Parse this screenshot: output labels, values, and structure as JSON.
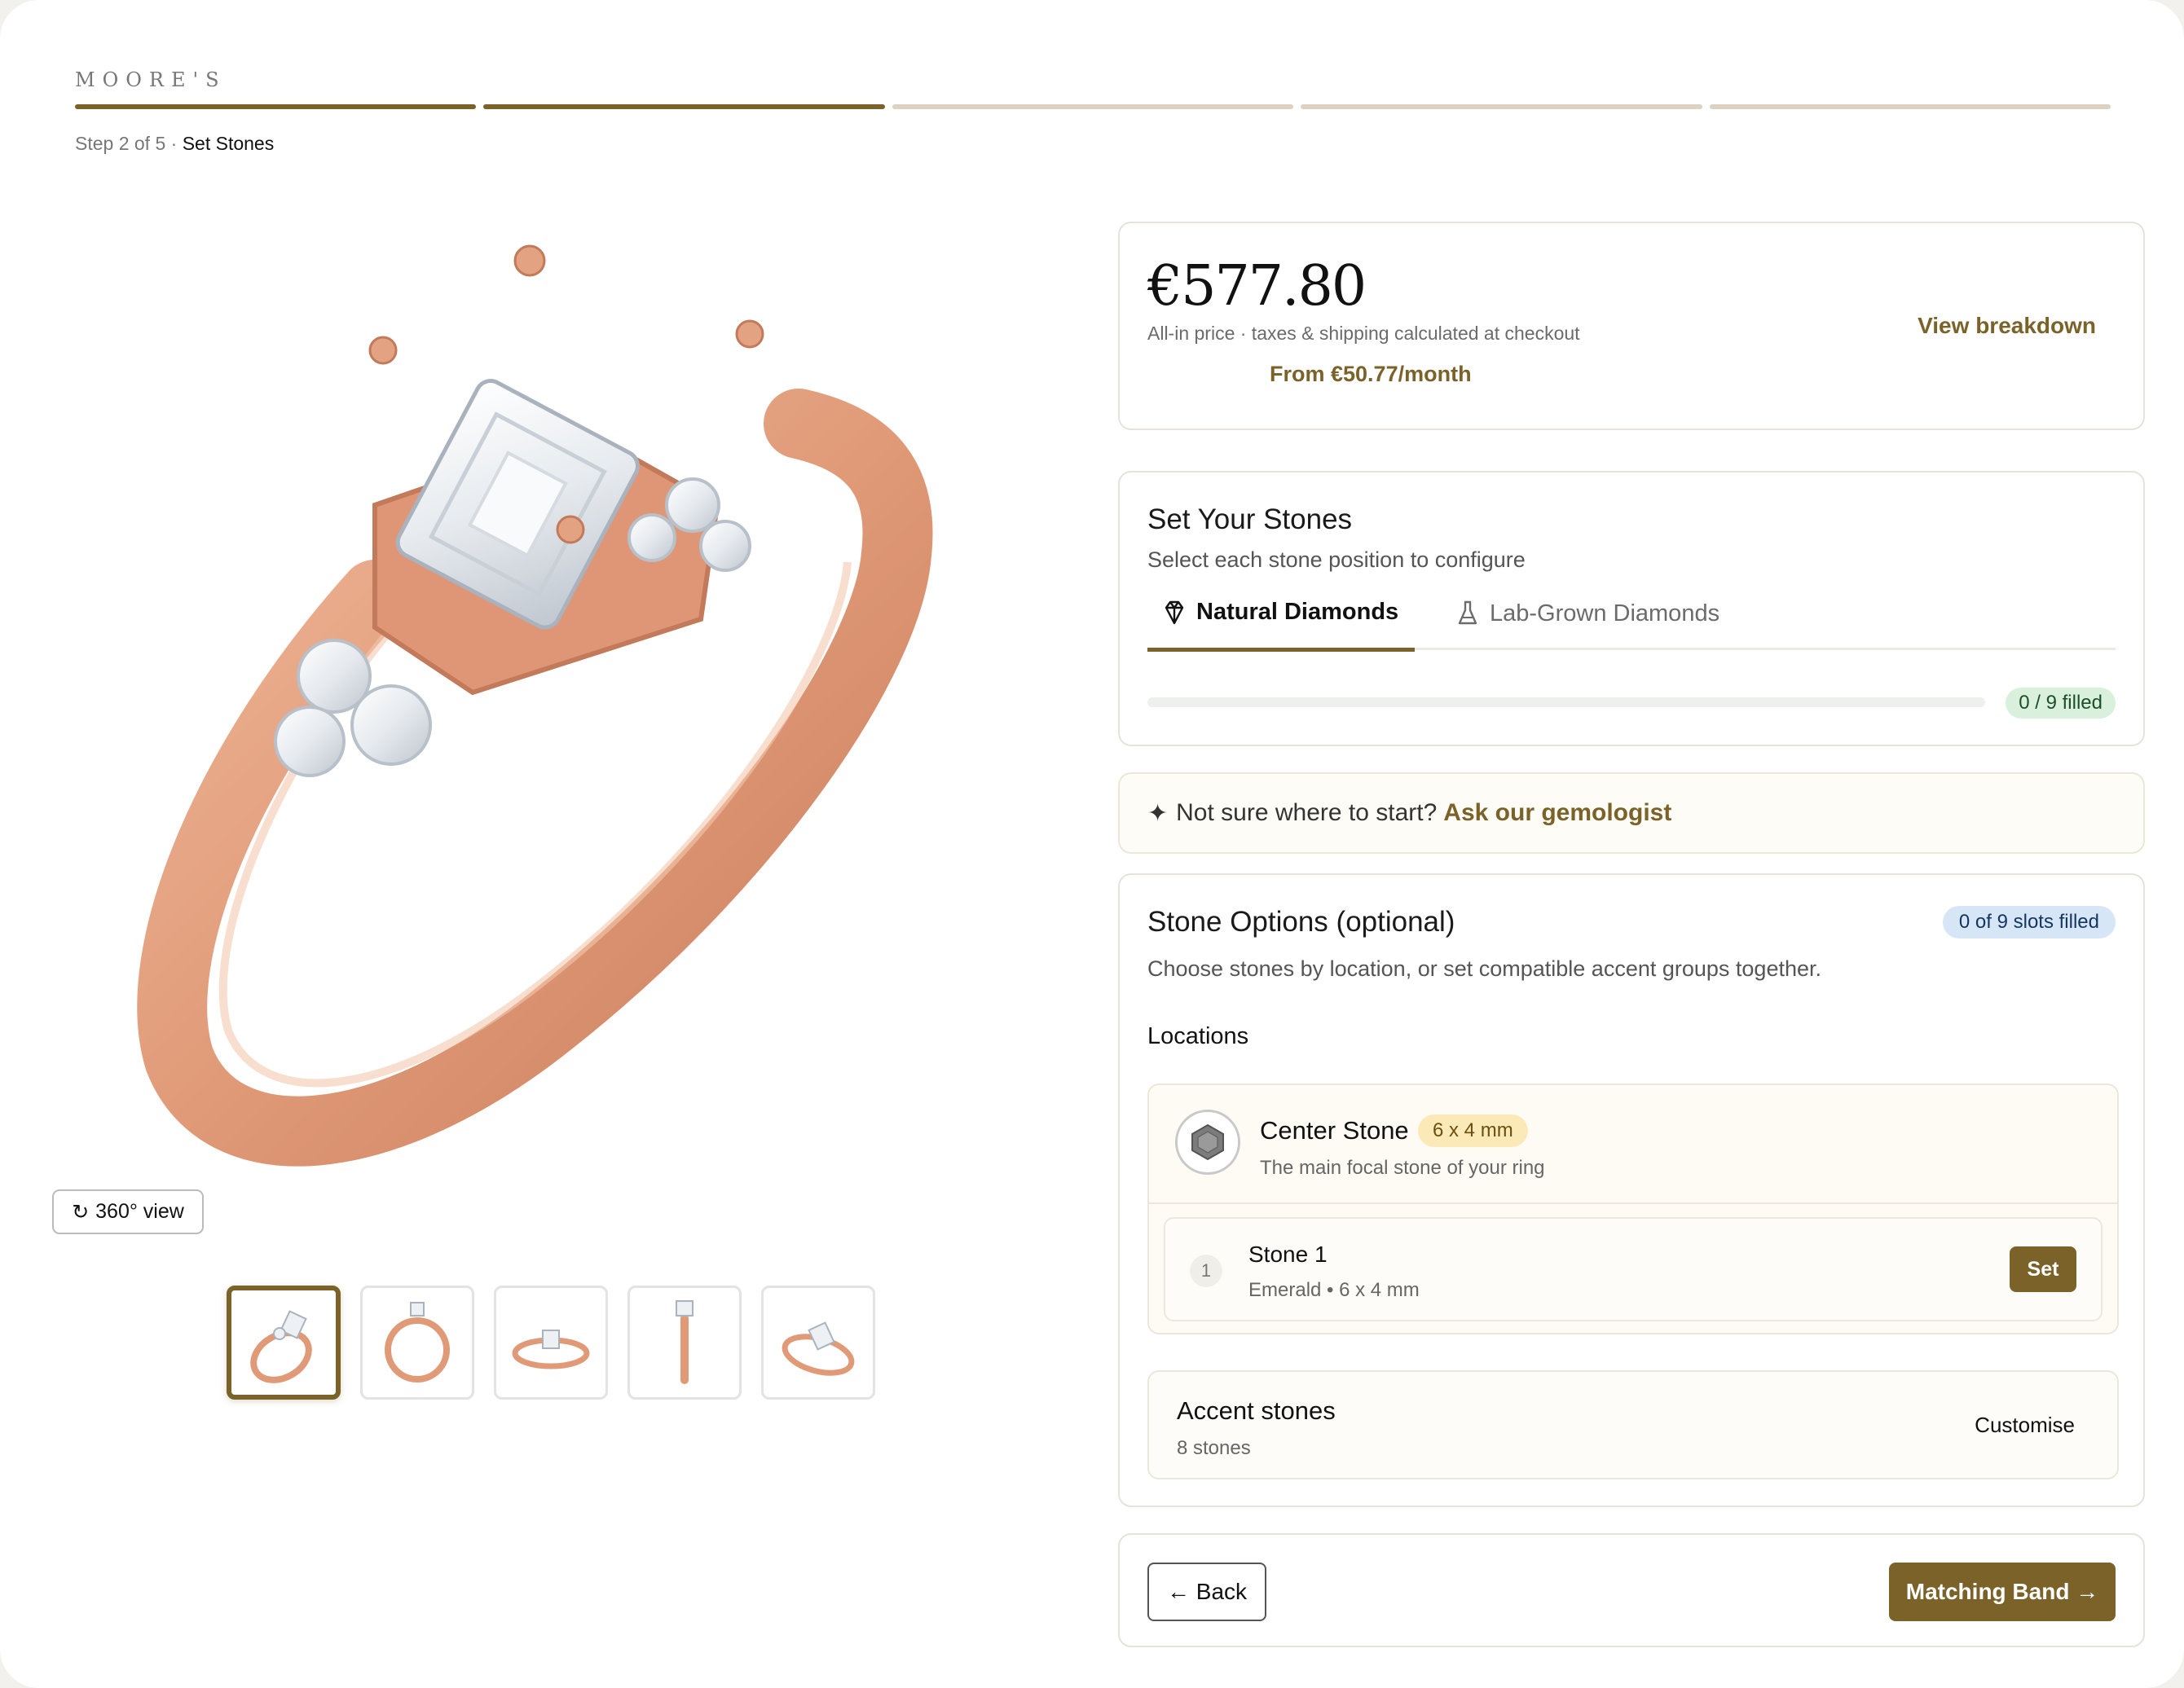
{
  "brand": "MOORE'S",
  "progress": {
    "total_steps": 5,
    "completed_steps": 2
  },
  "step": {
    "prefix": "Step 2 of 5 · ",
    "current": "Set Stones"
  },
  "gallery": {
    "view360_label": "360° view",
    "thumbnails": [
      "ring-angle-view",
      "ring-front-view",
      "ring-top-view",
      "ring-side-view",
      "ring-perspective-view"
    ],
    "active_thumbnail": 0,
    "metal_color": "#e3a383"
  },
  "price": {
    "amount": "€577.80",
    "note": "All-in price · taxes & shipping calculated at checkout",
    "monthly": "From €50.77/month",
    "breakdown_link": "View breakdown"
  },
  "set_stones": {
    "title": "Set Your Stones",
    "subtitle": "Select each stone position to configure",
    "tabs": [
      {
        "label": "Natural Diamonds",
        "icon": "diamond-icon",
        "active": true
      },
      {
        "label": "Lab-Grown Diamonds",
        "icon": "flask-icon",
        "active": false
      }
    ],
    "filled_label": "0 / 9 filled",
    "filled_fraction": 0
  },
  "gemologist": {
    "prompt": "Not sure where to start?",
    "link": "Ask our gemologist",
    "icon": "sparkle-icon"
  },
  "stone_options": {
    "title": "Stone Options (optional)",
    "slots_badge": "0 of 9 slots filled",
    "description": "Choose stones by location, or set compatible accent groups together.",
    "locations_label": "Locations",
    "center_stone": {
      "title": "Center Stone",
      "size": "6 x 4 mm",
      "description": "The main focal stone of your ring",
      "icon": "hexagon-gem-icon",
      "stones": [
        {
          "number": "1",
          "name": "Stone 1",
          "spec": "Emerald • 6 x 4 mm",
          "action": "Set"
        }
      ]
    },
    "accent": {
      "title": "Accent stones",
      "count": "8 stones",
      "action": "Customise"
    }
  },
  "navigation": {
    "back": "← Back",
    "next": "Matching Band →"
  },
  "colors": {
    "accent": "#7a6229",
    "progress_inactive": "#ddd2c2",
    "filled_badge_bg": "#d8f0dc",
    "slots_badge_bg": "#d6e6f7",
    "size_badge_bg": "#fbe9b7"
  }
}
